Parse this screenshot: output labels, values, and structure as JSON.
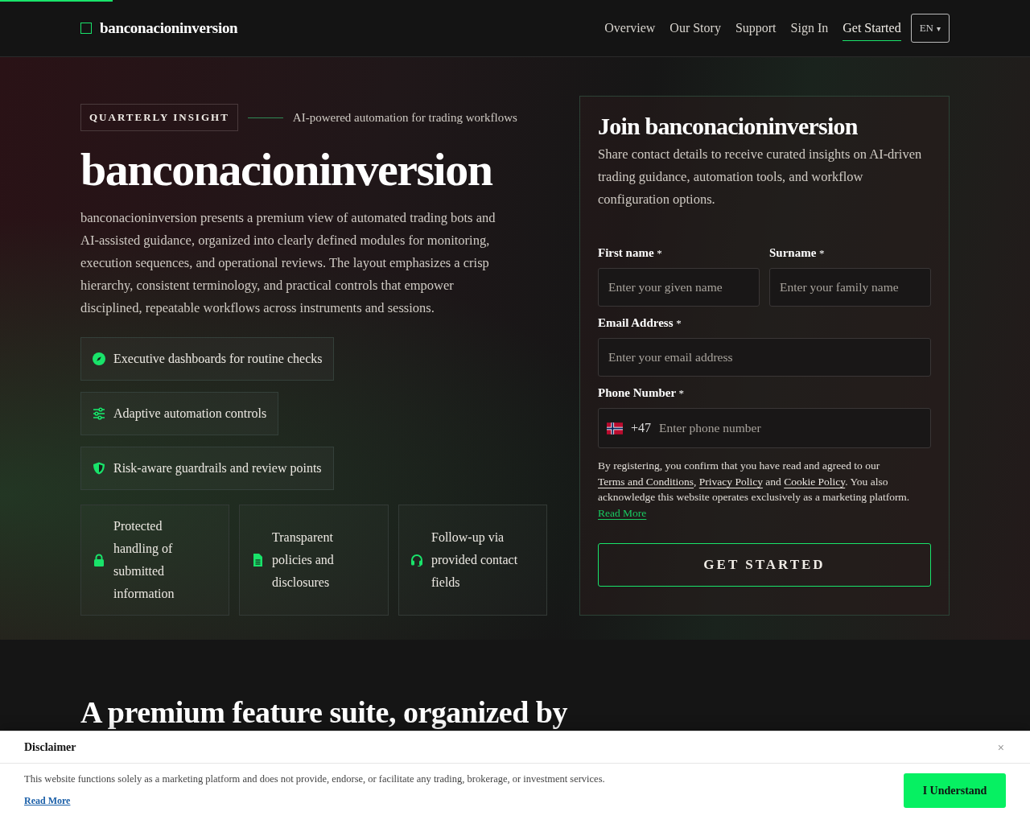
{
  "header": {
    "brand": "banconacioninversion",
    "nav": [
      {
        "label": "Overview",
        "selected": false
      },
      {
        "label": "Our Story",
        "selected": false
      },
      {
        "label": "Support",
        "selected": false
      },
      {
        "label": "Sign In",
        "selected": false
      },
      {
        "label": "Get Started",
        "selected": true
      }
    ],
    "language": {
      "label": "EN",
      "caret": "▾"
    }
  },
  "hero": {
    "badge": "QUARTERLY INSIGHT",
    "tagline": "AI-powered automation for trading workflows",
    "title": "banconacioninversion",
    "description": "banconacioninversion presents a premium view of automated trading bots and AI-assisted guidance, organized into clearly defined modules for monitoring, execution sequences, and operational reviews. The layout emphasizes a crisp hierarchy, consistent terminology, and practical controls that empower disciplined, repeatable workflows across instruments and sessions.",
    "features": [
      "Executive dashboards for routine checks",
      "Adaptive automation controls",
      "Risk-aware guardrails and review points"
    ],
    "assurances": [
      "Protected handling of submitted information",
      "Transparent policies and disclosures",
      "Follow-up via provided contact fields"
    ]
  },
  "form": {
    "title": "Join banconacioninversion",
    "intro": "Share contact details to receive curated insights on AI-driven trading guidance, automation tools, and workflow configuration options.",
    "fields": [
      {
        "label": "First name",
        "required": "*",
        "placeholder": "Enter your given name",
        "kind": "half"
      },
      {
        "label": "Surname",
        "required": "*",
        "placeholder": "Enter your family name",
        "kind": "half"
      },
      {
        "label": "Email Address",
        "required": "*",
        "placeholder": "Enter your email address",
        "kind": "full"
      },
      {
        "label": "Phone Number",
        "required": "*",
        "placeholder": "Enter phone number",
        "kind": "phone",
        "dial_code": "+47"
      }
    ],
    "consent": [
      {
        "kind": "text",
        "text": "By registering, you confirm that you have read and agreed to our "
      },
      {
        "kind": "link",
        "text": "Terms and Conditions"
      },
      {
        "kind": "text",
        "text": ", "
      },
      {
        "kind": "link",
        "text": "Privacy Policy"
      },
      {
        "kind": "text",
        "text": " and "
      },
      {
        "kind": "link",
        "text": "Cookie Policy"
      },
      {
        "kind": "text",
        "text": ". You also acknowledge this website operates exclusively as a marketing platform. "
      },
      {
        "kind": "accent",
        "text": "Read More"
      }
    ],
    "submit": "GET STARTED"
  },
  "next_section": {
    "heading": "A premium feature suite, organized by"
  },
  "disclaimer": {
    "title": "Disclaimer",
    "close": "×",
    "text": "This website functions solely as a marketing platform and does not provide, endorse, or facilitate any trading, brokerage, or investment services.",
    "link": "Read More",
    "button": "I Understand"
  }
}
